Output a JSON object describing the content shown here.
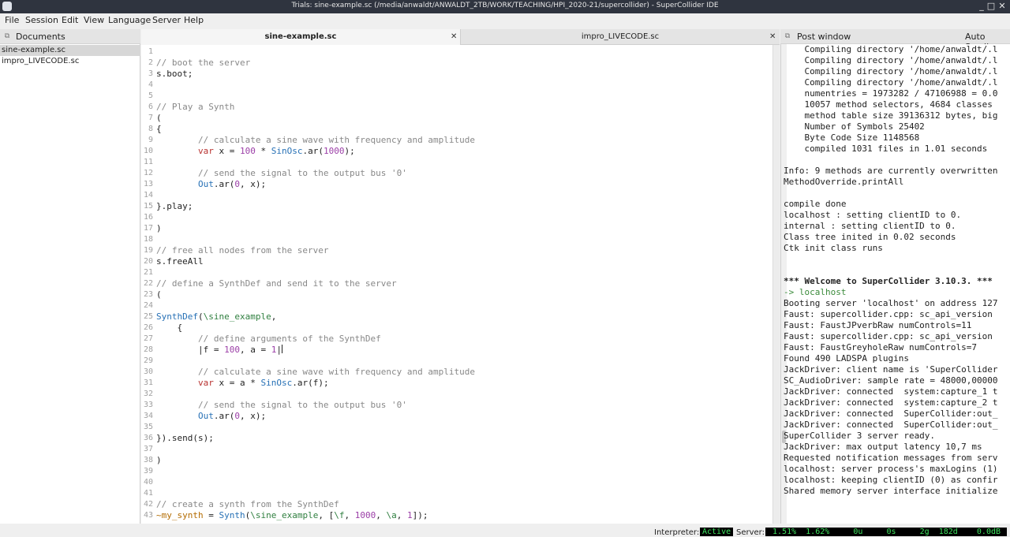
{
  "window": {
    "title": "Trials: sine-example.sc (/media/anwaldt/ANWALDT_2TB/WORK/TEACHING/HPI_2020-21/supercollider) - SuperCollider IDE",
    "controls": [
      "_",
      "□",
      "✕"
    ]
  },
  "menu": [
    "File",
    "Session",
    "Edit",
    "View",
    "Language",
    "Server",
    "Help"
  ],
  "documents_dock": {
    "title": "Documents",
    "items": [
      "sine-example.sc",
      "impro_LIVECODE.sc"
    ],
    "selected": "sine-example.sc"
  },
  "tabs": [
    {
      "label": "sine-example.sc",
      "active": true,
      "close": "✕"
    },
    {
      "label": "impro_LIVECODE.sc",
      "active": false,
      "close": "✕"
    }
  ],
  "editor": {
    "line_numbers": [
      "1",
      "2",
      "3",
      "4",
      "5",
      "6",
      "7",
      "8",
      "9",
      "10",
      "11",
      "12",
      "13",
      "14",
      "15",
      "16",
      "17",
      "18",
      "19",
      "20",
      "21",
      "22",
      "23",
      "24",
      "25",
      "26",
      "27",
      "28",
      "29",
      "30",
      "31",
      "32",
      "33",
      "34",
      "35",
      "36",
      "37",
      "38",
      "39",
      "40",
      "41",
      "42",
      "43"
    ],
    "lines": [
      "",
      "// boot the server",
      "s.boot;",
      "",
      "",
      "// Play a Synth",
      "(",
      "{",
      "        // calculate a sine wave with frequency and amplitude",
      "        var x = 100 * SinOsc.ar(1000);",
      "",
      "        // send the signal to the output bus '0'",
      "        Out.ar(0, x);",
      "",
      "}.play;",
      "",
      ")",
      "",
      "// free all nodes from the server",
      "s.freeAll",
      "",
      "// define a SynthDef and send it to the server",
      "(",
      "",
      "SynthDef(\\sine_example,",
      "    {",
      "        // define arguments of the SynthDef",
      "        |f = 100, a = 1|",
      "",
      "        // calculate a sine wave with frequency and amplitude",
      "        var x = a * SinOsc.ar(f);",
      "",
      "        // send the signal to the output bus '0'",
      "        Out.ar(0, x);",
      "",
      "}).send(s);",
      "",
      ")",
      "",
      "",
      "",
      "// create a synth from the SynthDef",
      "~my_synth = Synth(\\sine_example, [\\f, 1000, \\a, 1]);"
    ]
  },
  "post_window": {
    "title": "Post window",
    "auto_scroll": "Auto Scroll",
    "lines": [
      "    Compiling directory '/home/anwaldt/.l",
      "    Compiling directory '/home/anwaldt/.l",
      "    Compiling directory '/home/anwaldt/.l",
      "    Compiling directory '/home/anwaldt/.l",
      "    numentries = 1973282 / 47106988 = 0.0",
      "    10057 method selectors, 4684 classes",
      "    method table size 39136312 bytes, big",
      "    Number of Symbols 25402",
      "    Byte Code Size 1148568",
      "    compiled 1031 files in 1.01 seconds",
      "",
      "Info: 9 methods are currently overwritten",
      "MethodOverride.printAll",
      "",
      "compile done",
      "localhost : setting clientID to 0.",
      "internal : setting clientID to 0.",
      "Class tree inited in 0.02 seconds",
      "Ctk init class runs",
      "",
      "",
      "*** Welcome to SuperCollider 3.10.3. ***",
      "-> localhost",
      "Booting server 'localhost' on address 127",
      "Faust: supercollider.cpp: sc_api_version",
      "Faust: FaustJPverbRaw numControls=11",
      "Faust: supercollider.cpp: sc_api_version",
      "Faust: FaustGreyholeRaw numControls=7",
      "Found 490 LADSPA plugins",
      "JackDriver: client name is 'SuperCollider",
      "SC_AudioDriver: sample rate = 48000,00000",
      "JackDriver: connected  system:capture_1 t",
      "JackDriver: connected  system:capture_2 t",
      "JackDriver: connected  SuperCollider:out_",
      "JackDriver: connected  SuperCollider:out_",
      "SuperCollider 3 server ready.",
      "JackDriver: max output latency 10,7 ms",
      "Requested notification messages from serv",
      "localhost: server process's maxLogins (1)",
      "localhost: keeping clientID (0) as confir",
      "Shared memory server interface initialize"
    ]
  },
  "status": {
    "interpreter_label": "Interpreter:",
    "interpreter_state": "Active",
    "server_label": "Server:",
    "server_stats": " 1.51%  1.62%     0u     0s     2g  182d    0.0dB"
  }
}
